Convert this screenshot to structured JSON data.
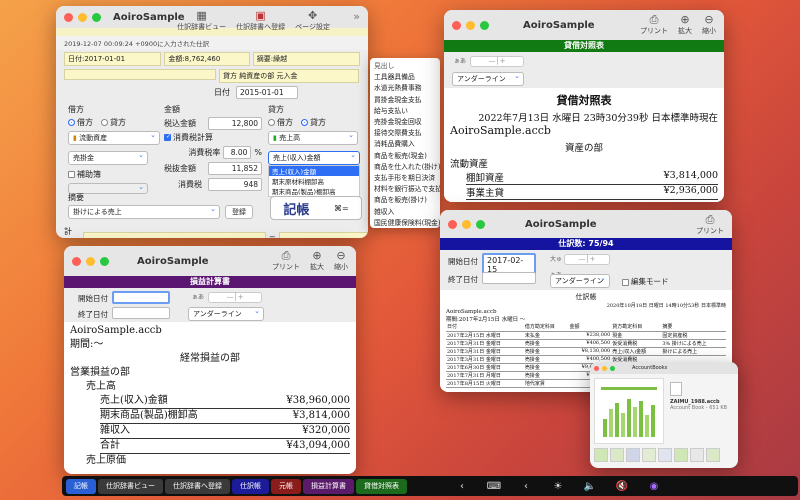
{
  "entry": {
    "title": "AoiroSample",
    "tools": [
      {
        "icon": "book-icon",
        "label": "仕訳辞書ビュー"
      },
      {
        "icon": "book-add-icon",
        "label": "仕訳辞書へ登録"
      },
      {
        "icon": "page-setup-icon",
        "label": "ページ設定"
      }
    ],
    "timestamp": "2019-12-07 00:09:24 +0900に入力された仕訳",
    "summary_date": "日付:2017-01-01",
    "summary_amount": "金額:8,762,460",
    "summary_memo": "摘要:繰越",
    "summary_note": "貸方 純資産の部 元入金",
    "date_label": "日付",
    "date_value": "2015-01-01",
    "debit_label": "借方",
    "amount_label": "金額",
    "credit_label": "貸方",
    "radio_debit": "借方",
    "radio_credit": "貸方",
    "debit_category": "流動資産",
    "debit_account": "売掛金",
    "aux_label": "補助簿",
    "tax_incl_label": "税込金額",
    "tax_incl_value": "12,800",
    "consumption_tax_calc": "消費税計算",
    "tax_rate_label": "消費税率",
    "tax_rate_value": "8.00",
    "tax_rate_unit": "%",
    "tax_excl_label": "税抜金額",
    "tax_excl_value": "11,852",
    "tax_label": "消費税",
    "tax_value": "948",
    "credit_category": "売上高",
    "credit_account": "売上(収入)金額",
    "credit_options": [
      "売上(収入)金額",
      "期末原材料棚卸高",
      "期末商品(製品)棚卸高"
    ],
    "memo_label": "摘要",
    "memo_value": "掛けによる売上",
    "register_label": "登録",
    "kicho_label": "記帳",
    "kicho_shortcut": "⌘=",
    "total_label": "計算",
    "equals": "="
  },
  "dict_menu": {
    "header": "見出し",
    "items": [
      "工具器具備品",
      "水道光熱費事務",
      "買掛金現金支払",
      "給与支払い",
      "売掛金現金回収",
      "接待交際費支払",
      "消耗品費購入",
      "商品を販売(現金)",
      "商品を仕入れた(掛け)",
      "支払手形を期日決済",
      "材料を銀行振込で支払",
      "商品を販売(掛け)",
      "雑収入",
      "国民健康保険料(現金)"
    ]
  },
  "balance": {
    "title": "AoiroSample",
    "tools": [
      {
        "icon": "printer-icon",
        "label": "プリント"
      },
      {
        "icon": "zoom-in-icon",
        "label": "拡大"
      },
      {
        "icon": "zoom-out-icon",
        "label": "縮小"
      }
    ],
    "band": "貸借対照表",
    "font_label": "ぁあ",
    "underline_option": "アンダーライン",
    "heading": "貸借対照表",
    "date_line": "2022年7月13日 水曜日 23時30分39秒 日本標準時現在",
    "file": "AoiroSample.accb",
    "section": "資産の部",
    "group": "流動資産",
    "rows": [
      {
        "name": "棚卸資産",
        "value": "¥3,814,000"
      },
      {
        "name": "事業主貸",
        "value": "¥2,936,000"
      }
    ]
  },
  "journal": {
    "title": "AoiroSample",
    "tools": [
      {
        "icon": "printer-icon",
        "label": "プリント"
      }
    ],
    "band": "仕訳数: 75/94",
    "start_label": "開始日付",
    "start_value": "2017-02-15",
    "end_label": "終了日付",
    "size_label": "大ゅ",
    "font_label": "ぁあ",
    "underline_option": "アンダーライン",
    "edit_mode": "編集モード",
    "sheet_title": "仕訳帳",
    "sheet_date": "2020年10月18日 日曜日 14時10分53秒 日本標準時",
    "file": "AoiroSample.accb",
    "period": "期間:2017年2月15日 水曜日 〜",
    "headers": [
      "日付",
      "借方勘定科目",
      "金額",
      "貸方勘定科目",
      "摘要"
    ],
    "rows": [
      [
        "2017年2月15日 水曜日",
        "未払金",
        "¥238,000",
        "現金",
        "固定資産税"
      ],
      [
        "2017年3月31日 金曜日",
        "売掛金",
        "¥406,500",
        "仮受消費税",
        "3% 掛けによる売上"
      ],
      [
        "2017年3月31日 金曜日",
        "売掛金",
        "¥8,130,000",
        "売上(収入)金額",
        "掛けによる売上"
      ],
      [
        "2017年3月31日 金曜日",
        "売掛金",
        "¥400,500",
        "仮受消費税",
        ""
      ],
      [
        "2017年6月30日 金曜日",
        "売掛金",
        "¥9,610,000",
        "売上(収入)金額",
        ""
      ],
      [
        "2017年7月31日 月曜日",
        "売掛金",
        "¥400,000",
        "",
        ""
      ],
      [
        "2017年8月15日 火曜日",
        "地代家賃",
        "¥9,000",
        "",
        ""
      ]
    ]
  },
  "income": {
    "title": "AoiroSample",
    "tools": [
      {
        "icon": "printer-icon",
        "label": "プリント"
      },
      {
        "icon": "zoom-in-icon",
        "label": "拡大"
      },
      {
        "icon": "zoom-out-icon",
        "label": "縮小"
      }
    ],
    "band": "損益計算書",
    "start_label": "開始日付",
    "end_label": "終了日付",
    "font_label": "ぁあ",
    "underline_option": "アンダーライン",
    "file": "AoiroSample.accb",
    "period": "期間:〜",
    "section": "経常損益の部",
    "group": "営業損益の部",
    "subgroup": "売上高",
    "rows": [
      {
        "name": "売上(収入)金額",
        "value": "¥38,960,000"
      },
      {
        "name": "期末商品(製品)棚卸高",
        "value": "¥3,814,000"
      },
      {
        "name": "雑収入",
        "value": "¥320,000"
      },
      {
        "name": "合計",
        "value": "¥43,094,000"
      }
    ],
    "next_row": "売上原価"
  },
  "finder": {
    "title": "AccountBooks",
    "file_name": "ZAIMU_1988.accb",
    "file_meta": "Account Book - 651 KB"
  },
  "dock": {
    "buttons": [
      {
        "label": "記帳",
        "color": "#2a5fd6"
      },
      {
        "label": "仕訳辞書ビュー",
        "color": "#3a3a3a"
      },
      {
        "label": "仕訳辞書へ登録",
        "color": "#3a3a3a"
      },
      {
        "label": "仕訳帳",
        "color": "#1c1c9a"
      },
      {
        "label": "元帳",
        "color": "#8a1c1c"
      },
      {
        "label": "損益計算書",
        "color": "#5a1c6a"
      },
      {
        "label": "貸借対照表",
        "color": "#1c6a1c"
      }
    ]
  }
}
